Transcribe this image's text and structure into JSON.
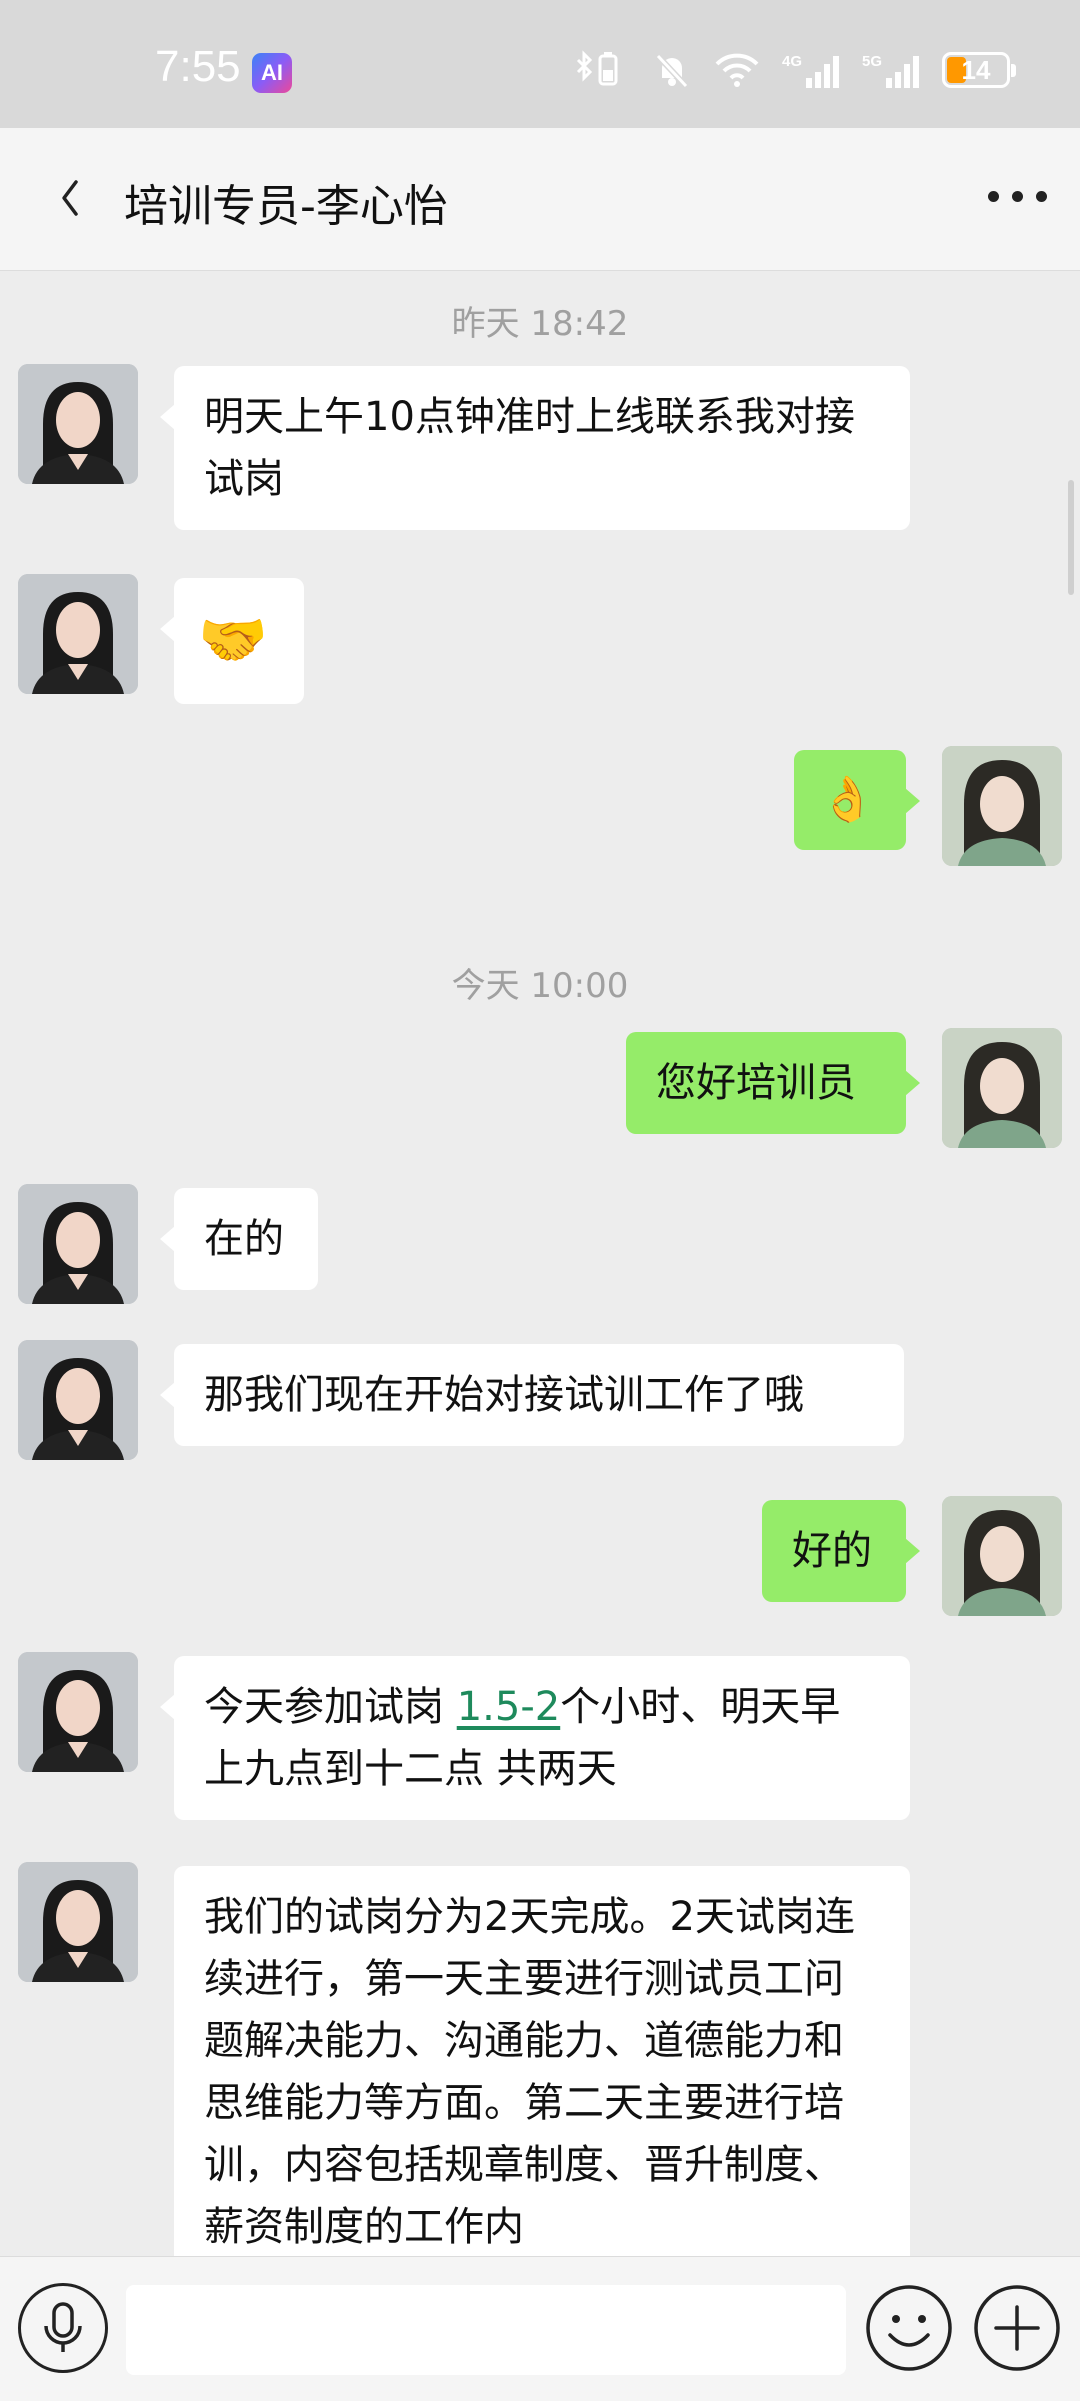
{
  "status_bar": {
    "time": "7:55",
    "ai_badge": "AI",
    "battery": "14"
  },
  "header": {
    "title": "培训专员-李心怡"
  },
  "timestamps": {
    "yesterday": "昨天 18:42",
    "today": "今天 10:00"
  },
  "messages": [
    {
      "side": "in",
      "text": "明天上午10点钟准时上线联系我对接试岗"
    },
    {
      "side": "in",
      "text": "🤝",
      "emoji_name": "handshake"
    },
    {
      "side": "out",
      "text": "👌",
      "emoji_name": "ok-hand"
    },
    {
      "side": "out",
      "text": "您好培训员"
    },
    {
      "side": "in",
      "text": "在的"
    },
    {
      "side": "in",
      "text": "那我们现在开始对接试训工作了哦"
    },
    {
      "side": "out",
      "text": "好的"
    },
    {
      "side": "in",
      "text_before": "今天参加试岗 ",
      "link": "1.5-2",
      "text_after": "个小时、明天早上九点到十二点 共两天"
    },
    {
      "side": "in",
      "text": "我们的试岗分为2天完成。2天试岗连续进行，第一天主要进行测试员工问题解决能力、沟通能力、道德能力和思维能力等方面。第二天主要进行培训，内容包括规章制度、晋升制度、薪资制度的工作内"
    }
  ],
  "input": {
    "placeholder": ""
  },
  "icons": {
    "back": "chevron-left-icon",
    "more": "more-dots-icon",
    "voice": "microphone-icon",
    "emoji": "smiley-icon",
    "plus": "plus-icon"
  },
  "colors": {
    "outgoing_bubble": "#95ec69",
    "incoming_bubble": "#ffffff",
    "background": "#ededed",
    "link": "#1e8a5c"
  }
}
